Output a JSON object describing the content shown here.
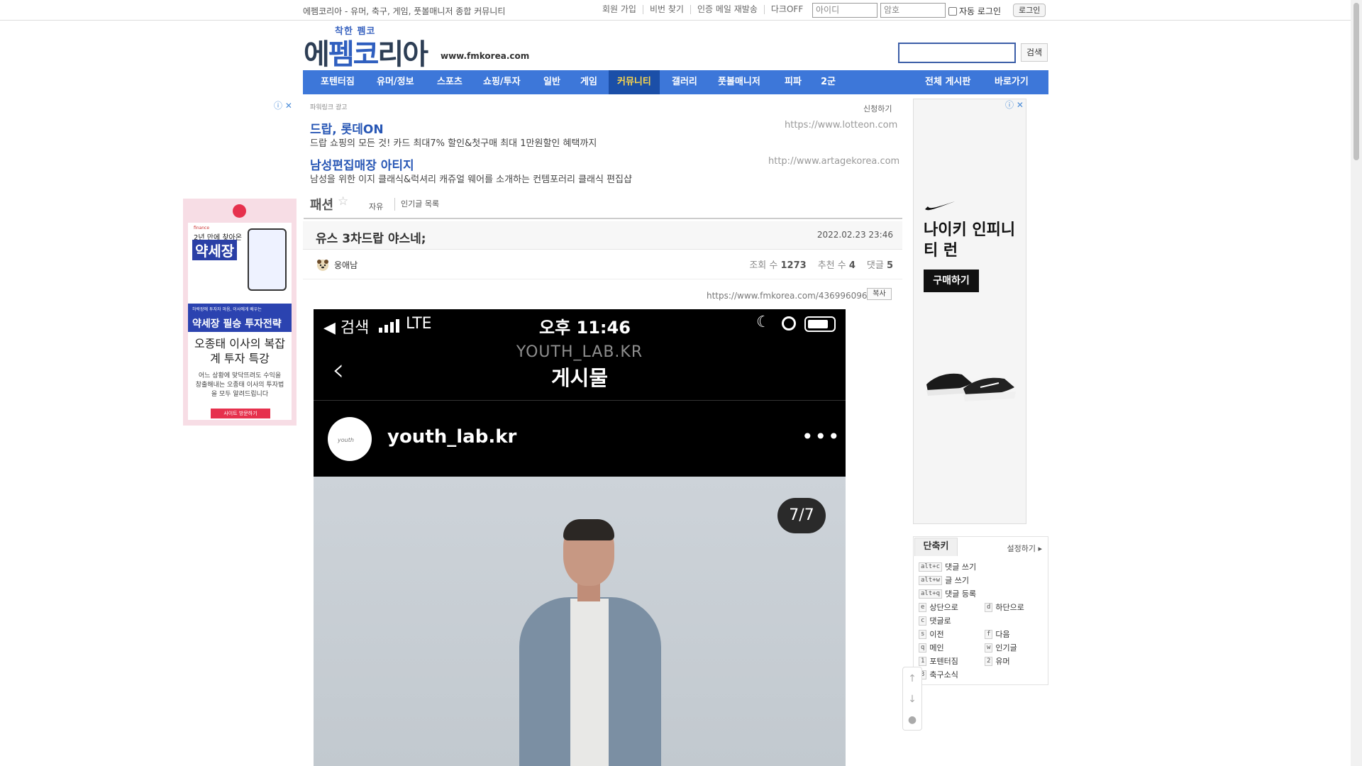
{
  "topbar": {
    "site_desc": "에펨코리아 - 유머, 축구, 게임, 풋볼매니저 종합 커뮤니티",
    "links": [
      "회원 가입",
      "비번 찾기",
      "인증 메일 재발송",
      "다크OFF"
    ],
    "id_placeholder": "아이디",
    "pw_placeholder": "암호",
    "autologin_label": "자동 로그인",
    "login_label": "로그인"
  },
  "header": {
    "logo_small": "착한 펨코",
    "logo_main_a": "에",
    "logo_main_b": "펨코",
    "logo_main_c": "리아",
    "domain": "www.fmkorea.com",
    "search_label": "검색"
  },
  "nav": {
    "items": [
      "포텐터짐",
      "유머/정보",
      "스포츠",
      "쇼핑/투자",
      "일반",
      "게임",
      "커뮤니티",
      "갤러리",
      "풋볼매니저",
      "피파",
      "2군"
    ],
    "active": "커뮤니티",
    "right_items": [
      "전체 게시판",
      "바로가기"
    ]
  },
  "ad_left": {
    "small": "finance",
    "line1": "2년 만에 찾아온",
    "line2": "약세장",
    "banner_small": "하락장에 투자자 마음, 이사에게 배우는",
    "banner_big": "약세장 필승 투자전략",
    "title": "오종태 이사의 복잡계 투자 특강",
    "desc": "어느 상황에 맞닥뜨려도 수익을 창출해내는 오종태 이사의 투자법을 모두 알려드립니다",
    "cta": "사이트 방문하기"
  },
  "powerlink": {
    "header": "파워링크 광고",
    "apply": "신청하기",
    "ads": [
      {
        "title": "드랍, 롯데ON",
        "desc": "드랍 쇼핑의 모든 것! 카드 최대7% 할인&첫구매 최대 1만원할인 혜택까지",
        "url": "https://www.lotteon.com"
      },
      {
        "title": "남성편집매장 아티지",
        "desc": "남성을 위한 이지 클래식&럭셔리 캐쥬얼 웨어를 소개하는 컨템포러리 클래식 편집샵",
        "url": "http://www.artagekorea.com"
      }
    ]
  },
  "board": {
    "name": "패션",
    "tab1": "자유",
    "tab2": "인기글 목록"
  },
  "post": {
    "title": "유스 3차드랍 야스네;",
    "date": "2022.02.23 23:46",
    "author": "웅애남",
    "views_label": "조회 수",
    "views": "1273",
    "recommend_label": "추천 수",
    "recommend": "4",
    "comments_label": "댓글",
    "comments": "5",
    "url": "https://www.fmkorea.com/4369960961",
    "copy_label": "복사"
  },
  "screenshot": {
    "back_label": "◀ 검색",
    "network": "LTE",
    "time": "오후 11:46",
    "ig_user_top": "YOUTH_LAB.KR",
    "ig_heading": "게시물",
    "ig_username": "youth_lab.kr",
    "avatar_text": "youth",
    "counter": "7/7"
  },
  "ad_right": {
    "title": "나이키 인피니티 런",
    "button": "구매하기"
  },
  "shortcuts": {
    "tab": "단축키",
    "setting": "설정하기",
    "items": [
      {
        "key": "alt+c",
        "label": "댓글 쓰기"
      },
      {
        "key": "alt+w",
        "label": "글 쓰기"
      },
      {
        "key": "alt+q",
        "label": "댓글 등록"
      },
      {
        "key": "e",
        "label": "상단으로"
      },
      {
        "key": "d",
        "label": "하단으로"
      },
      {
        "key": "c",
        "label": "댓글로"
      },
      {
        "key": "s",
        "label": "이전"
      },
      {
        "key": "f",
        "label": "다음"
      },
      {
        "key": "q",
        "label": "메인"
      },
      {
        "key": "w",
        "label": "인기글"
      },
      {
        "key": "1",
        "label": "포텐터짐"
      },
      {
        "key": "2",
        "label": "유머"
      },
      {
        "key": "3",
        "label": "축구소식"
      }
    ]
  },
  "colors": {
    "nav_bg": "#3d77d9",
    "nav_active_bg": "#1b4fa8",
    "nav_active_text": "#ffd84a",
    "link_blue": "#2857b5"
  }
}
